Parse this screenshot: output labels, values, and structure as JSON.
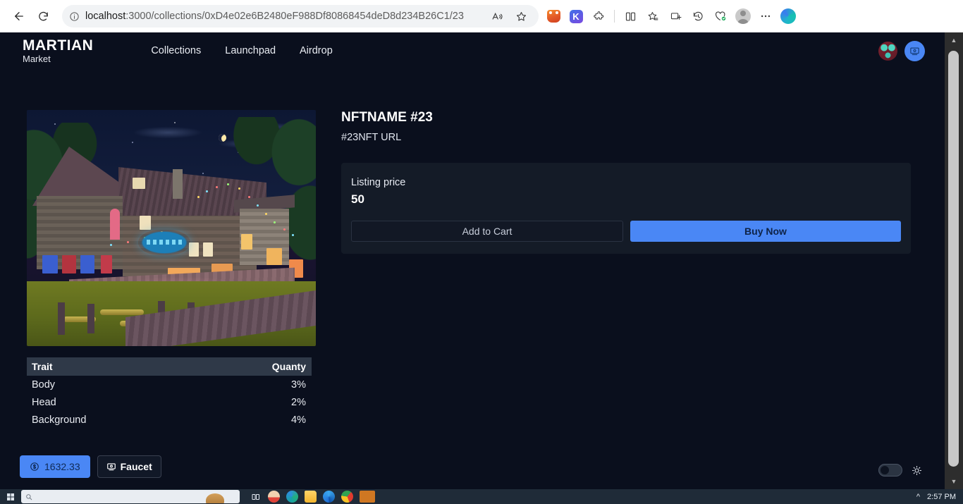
{
  "browser": {
    "back_title": "Back",
    "refresh_title": "Refresh",
    "url_prefix": "localhost",
    "url_rest": ":3000/collections/0xD4e02e6B2480eF988Df80868454deD8d234B26C1/23",
    "site_info_icon": "info-circle-icon",
    "read_aloud_icon": "read-aloud-icon",
    "favorite_icon": "star-icon",
    "toolbar_icons": [
      {
        "name": "metamask-extension-icon",
        "label": "MetaMask"
      },
      {
        "name": "keplr-extension-icon",
        "label": "K"
      },
      {
        "name": "extensions-icon",
        "label": "Extensions"
      },
      {
        "name": "split-screen-icon",
        "label": "Split screen"
      },
      {
        "name": "favorites-icon",
        "label": "Favorites"
      },
      {
        "name": "collections-icon",
        "label": "Collections"
      },
      {
        "name": "history-icon",
        "label": "History"
      },
      {
        "name": "browser-essentials-icon",
        "label": "Browser essentials"
      },
      {
        "name": "profile-avatar",
        "label": "Profile"
      },
      {
        "name": "settings-more-icon",
        "label": "Settings and more"
      },
      {
        "name": "copilot-icon",
        "label": "Copilot"
      }
    ]
  },
  "site": {
    "logo_line1": "MARTIAN",
    "logo_line2": "Market",
    "nav": [
      {
        "label": "Collections"
      },
      {
        "label": "Launchpad"
      },
      {
        "label": "Airdrop"
      }
    ],
    "avatar_name": "martian-avatar",
    "wallet_button_icon": "monitor-icon"
  },
  "nft": {
    "title": "NFTNAME #23",
    "subtitle": "#23NFT URL",
    "artwork_alt": "night-time swamp village illustration"
  },
  "listing": {
    "label": "Listing price",
    "price": "50",
    "add_to_cart_label": "Add to Cart",
    "buy_now_label": "Buy Now"
  },
  "traits": {
    "columns": [
      "Trait",
      "Quanty"
    ],
    "rows": [
      {
        "trait": "Body",
        "quanty": "3%"
      },
      {
        "trait": "Head",
        "quanty": "2%"
      },
      {
        "trait": "Background",
        "quanty": "4%"
      }
    ]
  },
  "footer": {
    "balance": "1632.33",
    "balance_icon": "dollar-circle-icon",
    "faucet_label": "Faucet",
    "faucet_icon": "monitor-icon",
    "theme_toggle_name": "theme-toggle",
    "theme_icon": "sun-icon"
  },
  "taskbar": {
    "start_icon": "windows-start-icon",
    "search_placeholder": "",
    "clock": "2:57 PM"
  },
  "colors": {
    "accent_blue": "#4a87f5",
    "page_bg": "#0a0f1d",
    "card_bg": "#141b27",
    "table_head_bg": "#2f3948"
  }
}
